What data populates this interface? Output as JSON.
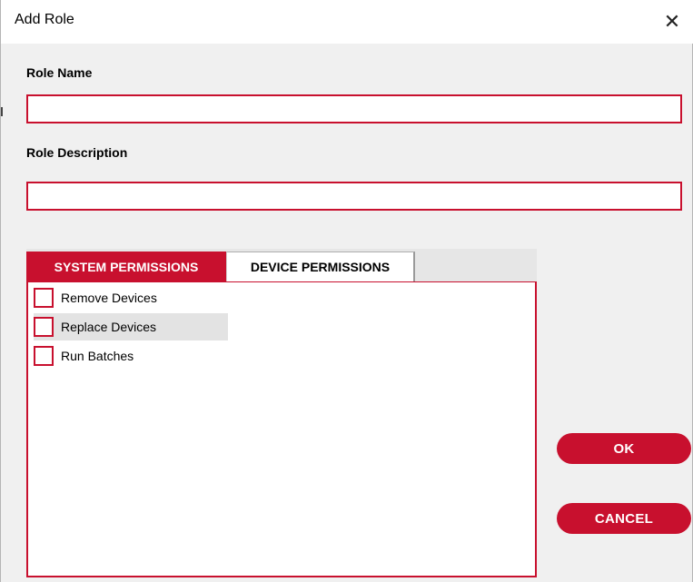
{
  "window": {
    "title": "Add Role",
    "close_glyph": "✕"
  },
  "form": {
    "role_name_label": "Role Name",
    "role_name_value": "",
    "role_description_label": "Role Description",
    "role_description_value": ""
  },
  "tabs": [
    {
      "label": "SYSTEM PERMISSIONS",
      "active": true
    },
    {
      "label": "DEVICE PERMISSIONS",
      "active": false
    }
  ],
  "permissions": [
    {
      "label": "Remove Devices",
      "checked": false
    },
    {
      "label": "Replace Devices",
      "checked": false
    },
    {
      "label": "Run Batches",
      "checked": false
    }
  ],
  "buttons": {
    "ok_label": "OK",
    "cancel_label": "CANCEL"
  },
  "colors": {
    "accent": "#c8102e",
    "background": "#f0f0f0",
    "titlebar": "#ffffff"
  },
  "icons": {
    "close": "close-icon"
  }
}
